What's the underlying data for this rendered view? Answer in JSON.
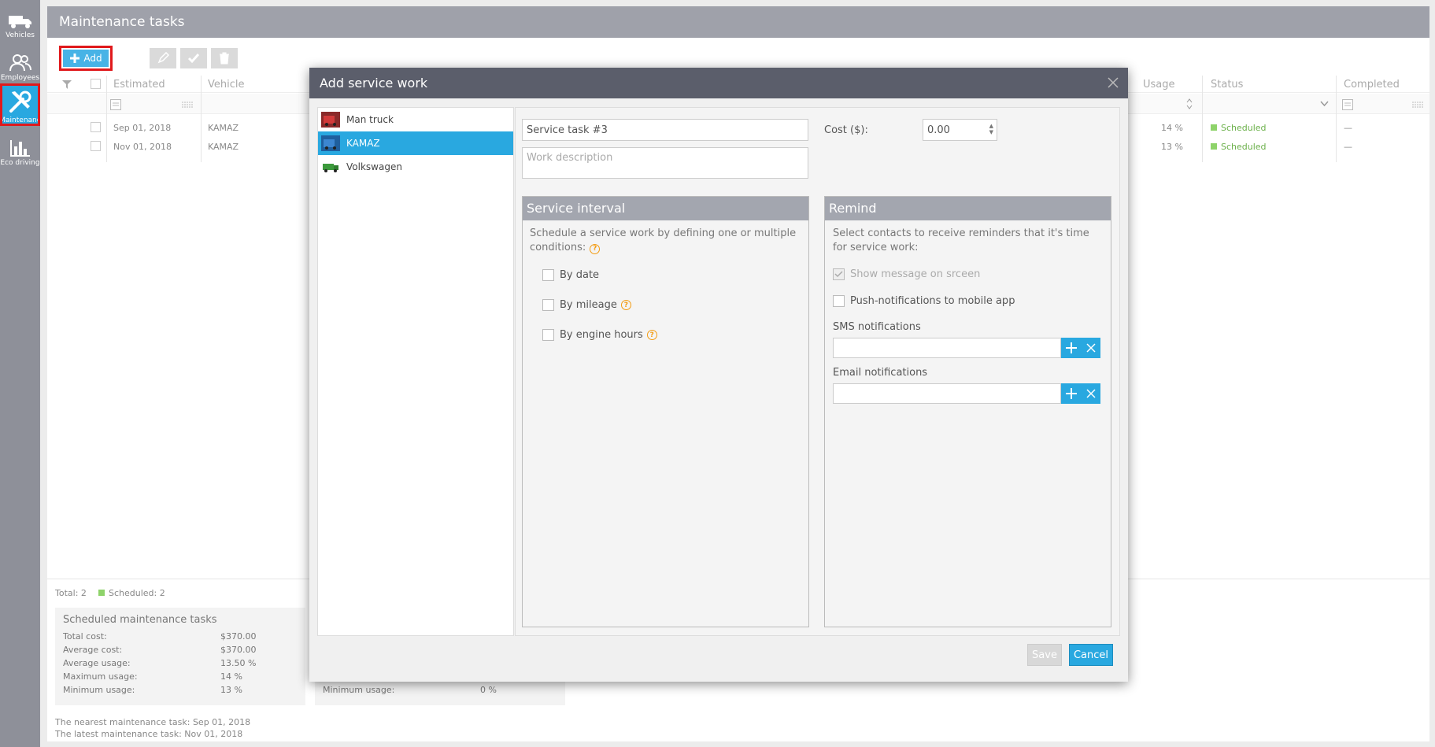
{
  "nav": [
    {
      "label": "Vehicles",
      "icon": "truck-icon"
    },
    {
      "label": "Employees",
      "icon": "people-icon"
    },
    {
      "label": "Maintenanc",
      "icon": "wrench-screwdriver-icon"
    },
    {
      "label": "Eco driving",
      "icon": "bar-chart-icon"
    }
  ],
  "page": {
    "title": "Maintenance tasks"
  },
  "toolbar": {
    "add_label": "Add"
  },
  "grid": {
    "columns": {
      "estimated": "Estimated",
      "vehicle": "Vehicle",
      "usage": "Usage",
      "status": "Status",
      "completed": "Completed"
    },
    "rows": [
      {
        "estimated": "Sep 01, 2018",
        "vehicle": "KAMAZ",
        "usage": "14 %",
        "status": "Scheduled",
        "completed": "—"
      },
      {
        "estimated": "Nov 01, 2018",
        "vehicle": "KAMAZ",
        "usage": "13 %",
        "status": "Scheduled",
        "completed": "—"
      }
    ]
  },
  "summary": {
    "total": "Total: 2",
    "scheduled_count": "Scheduled: 2",
    "box_title": "Scheduled maintenance tasks",
    "stats": [
      {
        "label": "Total cost:",
        "value": "$370.00"
      },
      {
        "label": "Average cost:",
        "value": "$370.00"
      },
      {
        "label": "Average usage:",
        "value": "13.50 %"
      },
      {
        "label": "Maximum usage:",
        "value": "14 %"
      },
      {
        "label": "Minimum usage:",
        "value": "13 %"
      }
    ],
    "box2_min_label": "Minimum usage:",
    "box2_min_value": "0 %",
    "nearest": "The nearest maintenance task: Sep 01, 2018",
    "latest": "The latest maintenance task: Nov 01, 2018"
  },
  "modal": {
    "title": "Add service work",
    "vehicles": [
      {
        "name": "Man truck",
        "selected": false
      },
      {
        "name": "KAMAZ",
        "selected": true
      },
      {
        "name": "Volkswagen",
        "selected": false
      }
    ],
    "task_name": "Service task #3",
    "description_placeholder": "Work description",
    "cost_label": "Cost ($):",
    "cost_value": "0.00",
    "interval": {
      "title": "Service interval",
      "text": "Schedule a service work by defining one or multiple conditions:",
      "by_date": "By date",
      "by_mileage": "By mileage",
      "by_engine_hours": "By engine hours"
    },
    "remind": {
      "title": "Remind",
      "text": "Select contacts to receive reminders that it's time for service work:",
      "show_message": "Show message on srceen",
      "push": "Push-notifications to mobile app",
      "sms": "SMS notifications",
      "email": "Email notifications"
    },
    "save_label": "Save",
    "cancel_label": "Cancel"
  },
  "colors": {
    "accent": "#29a8e0",
    "header": "#5b5e6b",
    "highlight": "#e0191c",
    "scheduled": "#8ed36a"
  }
}
